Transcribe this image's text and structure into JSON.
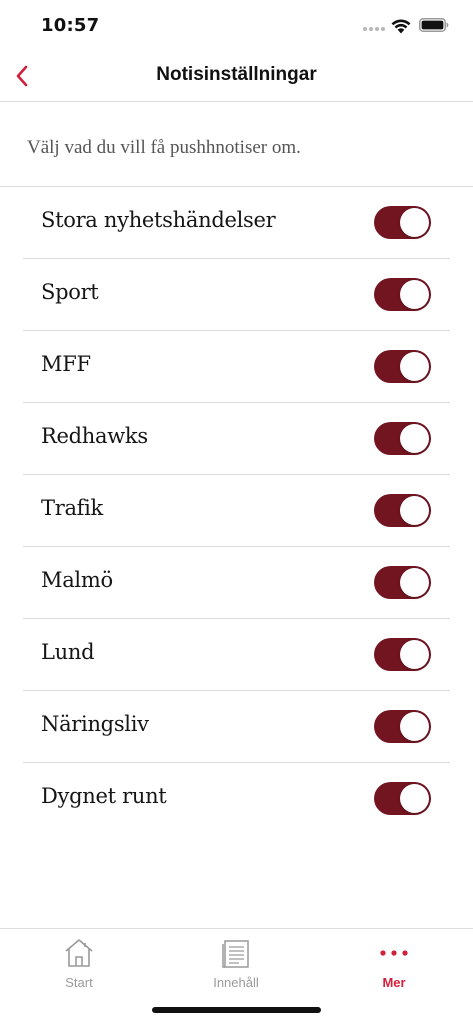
{
  "status_bar": {
    "time": "10:57",
    "icons": [
      "signal-dots-icon",
      "wifi-icon",
      "battery-icon"
    ]
  },
  "nav": {
    "title": "Notisinställningar",
    "back_icon": "chevron-left-icon"
  },
  "intro": "Välj vad du vill få pushhnotiser om.",
  "settings": [
    {
      "label": "Stora nyhetshändelser",
      "enabled": true
    },
    {
      "label": "Sport",
      "enabled": true
    },
    {
      "label": "MFF",
      "enabled": true
    },
    {
      "label": "Redhawks",
      "enabled": true
    },
    {
      "label": "Trafik",
      "enabled": true
    },
    {
      "label": "Malmö",
      "enabled": true
    },
    {
      "label": "Lund",
      "enabled": true
    },
    {
      "label": "Näringsliv",
      "enabled": true
    },
    {
      "label": "Dygnet runt",
      "enabled": true
    }
  ],
  "tabs": [
    {
      "label": "Start",
      "icon": "house-icon",
      "active": false
    },
    {
      "label": "Innehåll",
      "icon": "newspaper-icon",
      "active": false
    },
    {
      "label": "Mer",
      "icon": "more-dots-icon",
      "active": true
    }
  ],
  "colors": {
    "accent": "#d21f3a",
    "toggle_on": "#731421",
    "divider": "#dcdcdc",
    "tab_inactive": "#9a9a9a"
  }
}
